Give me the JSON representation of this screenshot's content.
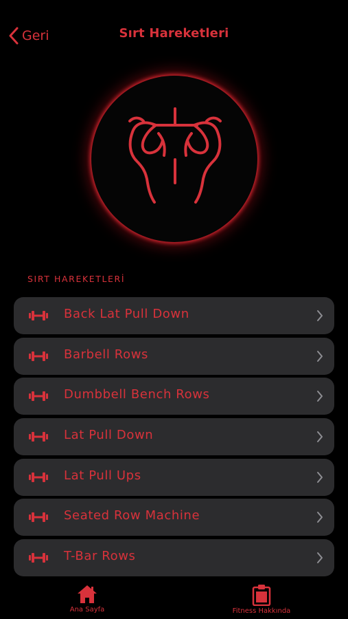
{
  "nav": {
    "back_label": "Geri",
    "title": "Sırt Hareketleri"
  },
  "hero": {
    "icon": "back-muscle-icon"
  },
  "section": {
    "label": "SIRT HAREKETLERİ"
  },
  "exercises": [
    {
      "label": "Back Lat Pull Down"
    },
    {
      "label": "Barbell Rows"
    },
    {
      "label": "Dumbbell Bench Rows"
    },
    {
      "label": "Lat Pull Down"
    },
    {
      "label": "Lat Pull Ups"
    },
    {
      "label": "Seated Row Machine"
    },
    {
      "label": "T-Bar Rows"
    }
  ],
  "tabbar": {
    "home_label": "Ana Sayfa",
    "info_label": "Fitness Hakkında"
  },
  "colors": {
    "accent": "#d8323b",
    "row_bg": "#2c2c2e",
    "background": "#000000"
  }
}
